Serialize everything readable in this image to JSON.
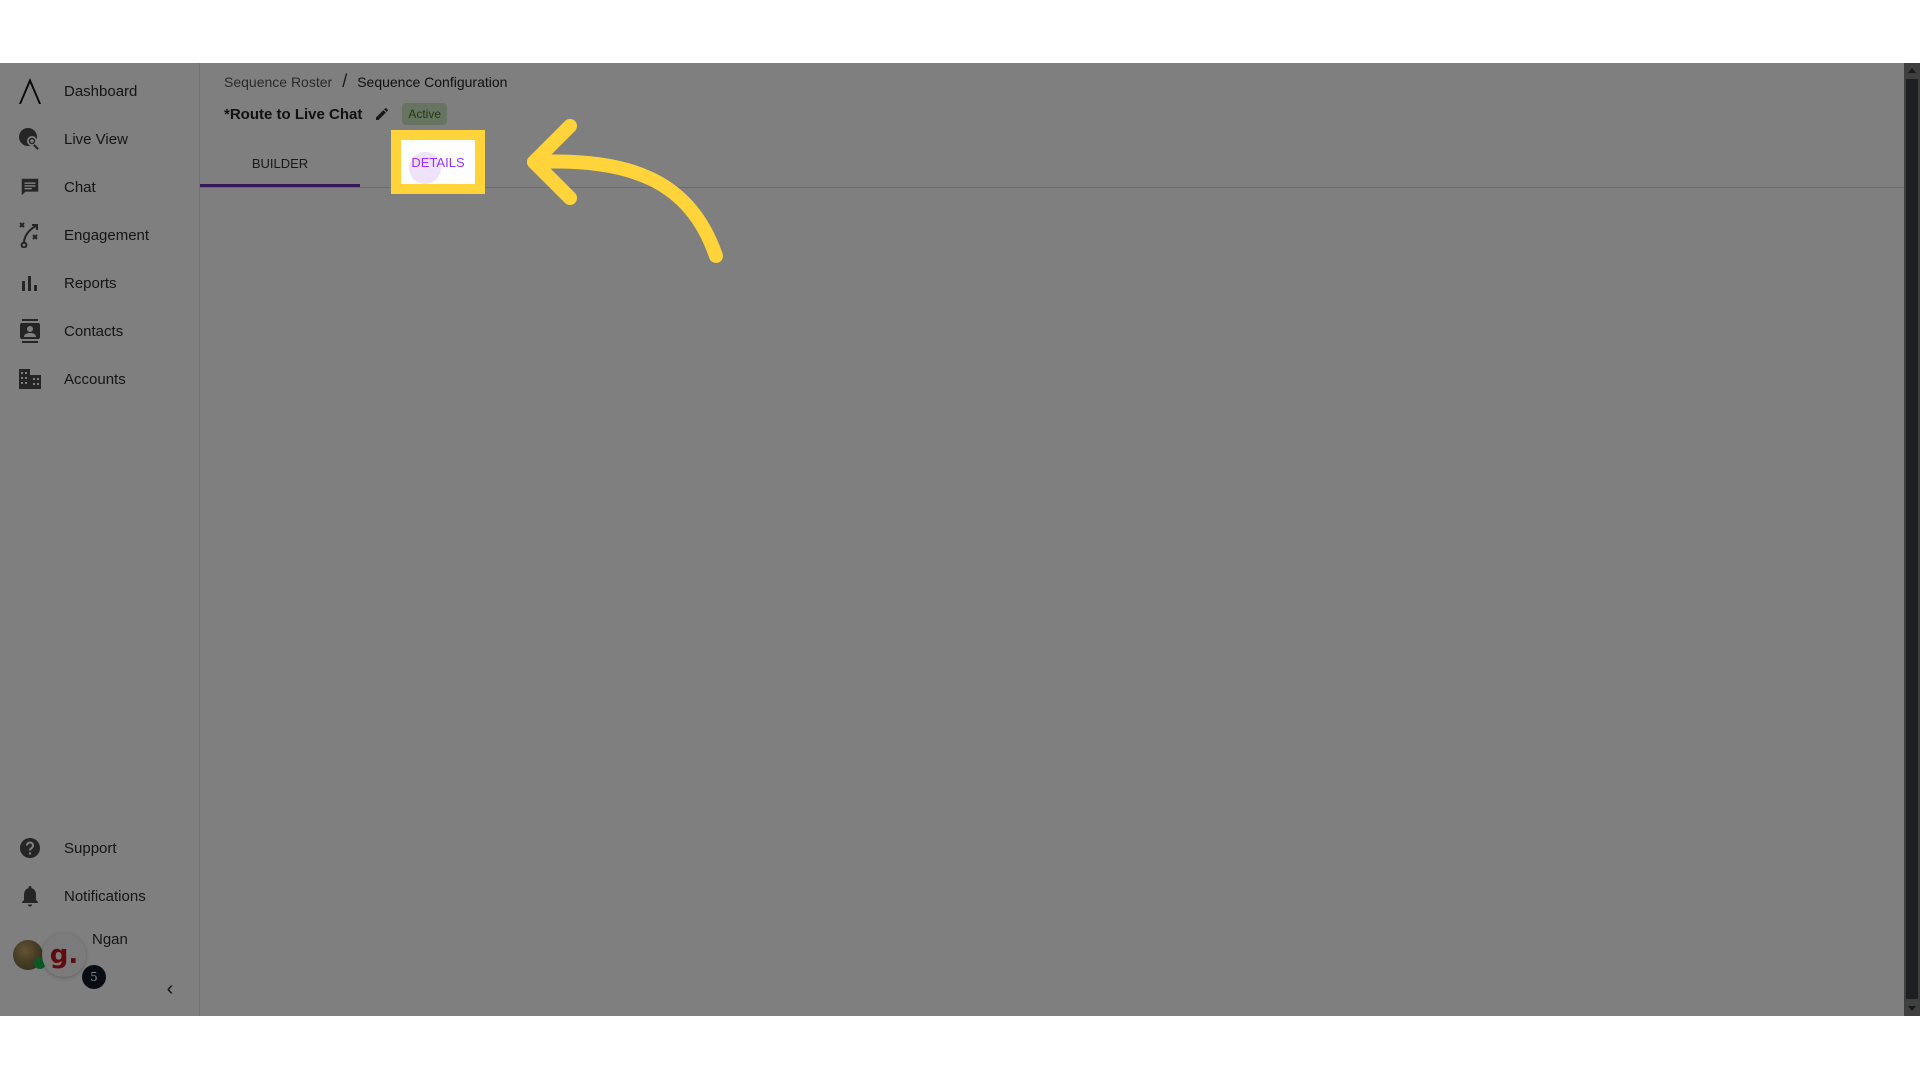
{
  "sidebar": {
    "items": [
      {
        "label": "Dashboard",
        "icon": "logo-icon"
      },
      {
        "label": "Live View",
        "icon": "globe-search-icon"
      },
      {
        "label": "Chat",
        "icon": "chat-icon"
      },
      {
        "label": "Engagement",
        "icon": "strategy-icon"
      },
      {
        "label": "Reports",
        "icon": "bar-chart-icon"
      },
      {
        "label": "Contacts",
        "icon": "contact-card-icon"
      },
      {
        "label": "Accounts",
        "icon": "building-icon"
      }
    ],
    "bottom_items": [
      {
        "label": "Support",
        "icon": "help-icon"
      },
      {
        "label": "Notifications",
        "icon": "bell-icon"
      }
    ],
    "user": {
      "name": "Ngan",
      "launcher_glyph": "g.",
      "launcher_badge": "5"
    },
    "collapse_glyph": "‹"
  },
  "breadcrumb": {
    "parent": "Sequence Roster",
    "separator": "/",
    "current": "Sequence Configuration"
  },
  "sequence": {
    "title": "*Route to Live Chat",
    "status": "Active"
  },
  "tabs": [
    {
      "label": "BUILDER",
      "active": true
    },
    {
      "label": "DETAILS",
      "active": false
    }
  ],
  "annotation": {
    "highlight_color": "#ffd43b",
    "highlighted_tab": "DETAILS"
  },
  "colors": {
    "accent": "#6a2fb5",
    "details_text": "#9b30ff",
    "status_bg": "#cfe8c4",
    "status_text": "#3c7a1f"
  }
}
